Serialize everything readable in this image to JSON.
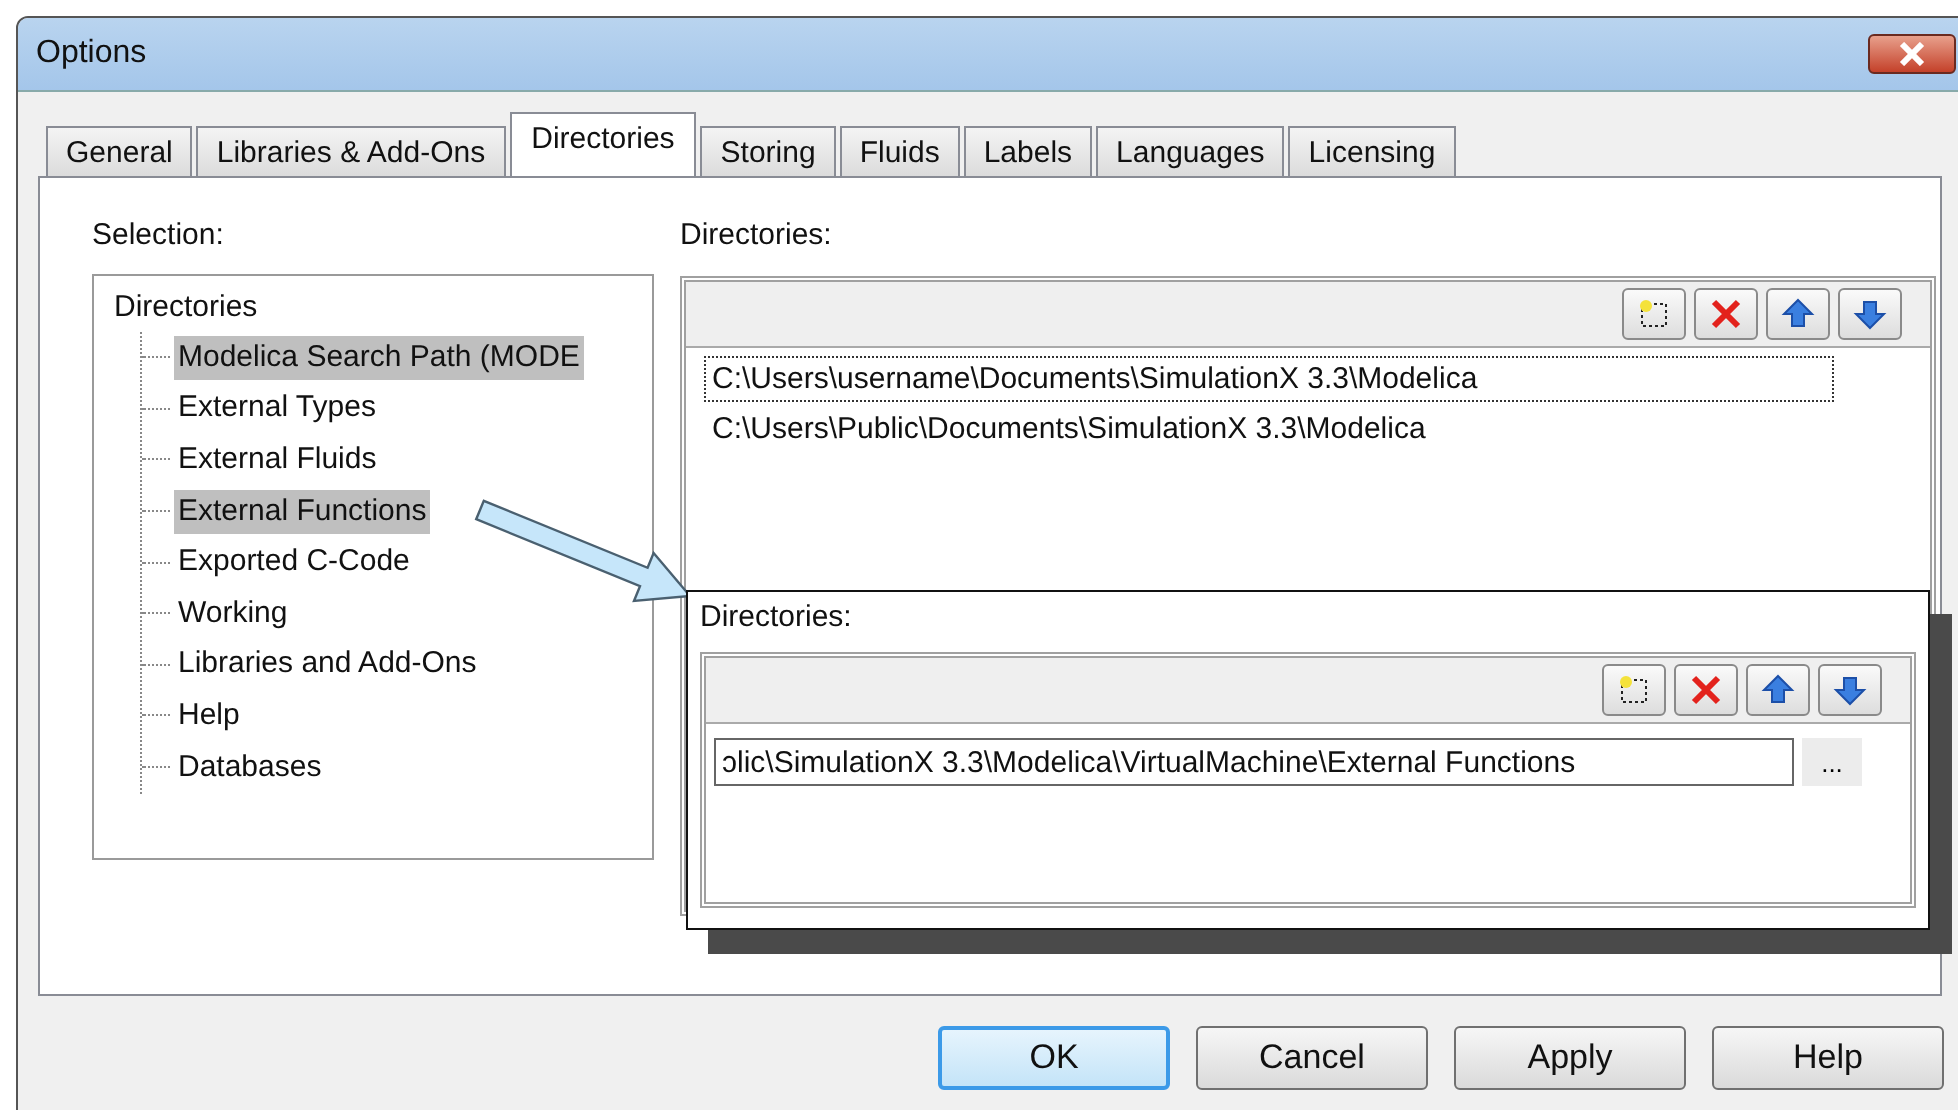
{
  "window": {
    "title": "Options"
  },
  "tabs": [
    {
      "label": "General",
      "selected": false
    },
    {
      "label": "Libraries & Add-Ons",
      "selected": false
    },
    {
      "label": "Directories",
      "selected": true
    },
    {
      "label": "Storing",
      "selected": false
    },
    {
      "label": "Fluids",
      "selected": false
    },
    {
      "label": "Labels",
      "selected": false
    },
    {
      "label": "Languages",
      "selected": false
    },
    {
      "label": "Licensing",
      "selected": false
    }
  ],
  "selection": {
    "label": "Selection:",
    "tree": {
      "label": "Directories",
      "children": [
        {
          "label": "Modelica Search Path (MODE",
          "selected": true
        },
        {
          "label": "External Types",
          "selected": false
        },
        {
          "label": "External Fluids",
          "selected": false
        },
        {
          "label": "External Functions",
          "selected": true
        },
        {
          "label": "Exported C-Code",
          "selected": false
        },
        {
          "label": "Working",
          "selected": false
        },
        {
          "label": "Libraries and Add-Ons",
          "selected": false
        },
        {
          "label": "Help",
          "selected": false
        },
        {
          "label": "Databases",
          "selected": false
        }
      ]
    }
  },
  "directories": {
    "label": "Directories:",
    "items": [
      {
        "text": "C:\\Users\\username\\Documents\\SimulationX 3.3\\Modelica",
        "focused": true
      },
      {
        "text": "C:\\Users\\Public\\Documents\\SimulationX 3.3\\Modelica",
        "focused": false
      }
    ]
  },
  "callout": {
    "label": "Directories:",
    "path_value": "ɔlic\\SimulationX 3.3\\Modelica\\VirtualMachine\\External Functions",
    "browse_button": "..."
  },
  "buttons": [
    {
      "label": "OK",
      "default": true
    },
    {
      "label": "Cancel",
      "default": false
    },
    {
      "label": "Apply",
      "default": false
    },
    {
      "label": "Help",
      "default": false
    }
  ]
}
